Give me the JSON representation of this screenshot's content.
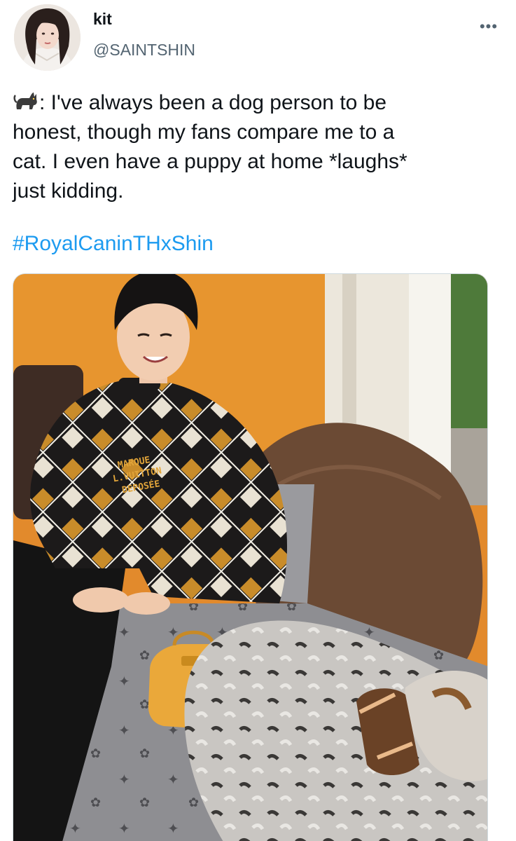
{
  "tweet": {
    "author": {
      "display_name": "kit",
      "handle": "@SAINTSHIN"
    },
    "more_icon": "more-horizontal-icon",
    "text": "🐈: I've always been a dog person to be honest, though my fans compare me to a cat. I even have a puppy at home *laughs* just kidding.",
    "text_lines": [
      ": I've always been a dog person to be",
      "honest, though my fans compare me to a",
      "cat. I even have a puppy at home *laughs*",
      "just kidding."
    ],
    "hashtag": "#RoyalCaninTHxShin",
    "sweater_print": [
      "MARQUE",
      "L.VUITTON",
      "DEPOSÉE"
    ]
  },
  "colors": {
    "link": "#1d9bf0",
    "text": "#0f1419",
    "secondary": "#536471"
  }
}
